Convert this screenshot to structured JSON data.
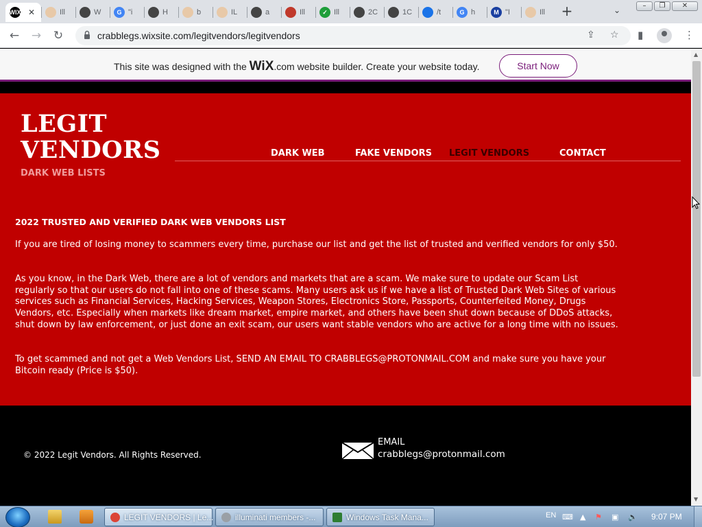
{
  "browser": {
    "tabs": [
      {
        "label": "WIX",
        "title": "",
        "active": true,
        "favicon_color": "#000000",
        "favicon_name": "wix-favicon-icon"
      },
      {
        "label": "",
        "title": "Ill",
        "favicon_color": "#e8c9a8",
        "favicon_name": "pyramid-favicon-icon"
      },
      {
        "label": "",
        "title": "W",
        "favicon_color": "#444444",
        "favicon_name": "globe-favicon-icon"
      },
      {
        "label": "G",
        "title": "\"i",
        "favicon_color": "#4285f4",
        "favicon_name": "google-favicon-icon"
      },
      {
        "label": "",
        "title": "H",
        "favicon_color": "#444444",
        "favicon_name": "globe-favicon-icon"
      },
      {
        "label": "",
        "title": "b",
        "favicon_color": "#e8c9a8",
        "favicon_name": "pyramid-favicon-icon"
      },
      {
        "label": "",
        "title": "IL",
        "favicon_color": "#e8c9a8",
        "favicon_name": "pyramid-favicon-icon"
      },
      {
        "label": "",
        "title": "a",
        "favicon_color": "#444444",
        "favicon_name": "globe-favicon-icon"
      },
      {
        "label": "",
        "title": "Ill",
        "favicon_color": "#c0392b",
        "favicon_name": "red-figure-favicon-icon"
      },
      {
        "label": "✓",
        "title": "Ill",
        "favicon_color": "#1e9e3a",
        "favicon_name": "green-check-favicon-icon"
      },
      {
        "label": "",
        "title": "2C",
        "favicon_color": "#444444",
        "favicon_name": "globe-favicon-icon"
      },
      {
        "label": "",
        "title": "1C",
        "favicon_color": "#444444",
        "favicon_name": "globe-favicon-icon"
      },
      {
        "label": "",
        "title": "/t",
        "favicon_color": "#1a73e8",
        "favicon_name": "cloud-favicon-icon"
      },
      {
        "label": "G",
        "title": "h",
        "favicon_color": "#4285f4",
        "favicon_name": "google-favicon-icon"
      },
      {
        "label": "M",
        "title": "\"I",
        "favicon_color": "#1a3fa0",
        "favicon_name": "malwarebytes-favicon-icon"
      },
      {
        "label": "",
        "title": "Ill",
        "favicon_color": "#e8c9a8",
        "favicon_name": "pyramid-favicon-icon"
      }
    ],
    "new_tab": "+",
    "url": "crabblegs.wixsite.com/legitvendors/legitvendors"
  },
  "wix_banner": {
    "text_before": "This site was designed with the ",
    "brand": "WiX",
    "text_after": ".com website builder. Create your website today.",
    "button": "Start Now"
  },
  "site": {
    "logo_line1": "LEGIT",
    "logo_line2": "VENDORS",
    "logo_subtitle": "DARK WEB LISTS",
    "nav": [
      {
        "label": "DARK WEB"
      },
      {
        "label": "FAKE VENDORS"
      },
      {
        "label": "LEGIT VENDORS",
        "current": true
      },
      {
        "label": "CONTACT"
      }
    ],
    "heading": "2022 TRUSTED AND VERIFIED DARK WEB VENDORS LIST",
    "paragraphs": [
      "If you are tired of losing money to scammers every time, purchase our list and get the list of trusted and verified vendors for only $50.",
      "As you know, in the Dark Web, there are a lot of vendors and markets that are a scam. We make sure to update our Scam List regularly so that our users do not fall into one of these scams. Many users ask us if we have a list of Trusted Dark Web Sites of various services such as Financial Services, Hacking Services, Weapon Stores, Electronics Store, Passports, Counterfeited Money, Drugs Vendors, etc. Especially when markets like dream market, empire market, and others have been shut down because of DDoS attacks, shut down by law enforcement, or just done an exit scam, our users want stable vendors who are active for a long time with no issues.",
      "To get scammed and not get a Web Vendors List, SEND AN EMAIL TO CRABBLEGS@PROTONMAIL.COM and make sure you have your Bitcoin ready (Price is $50)."
    ],
    "footer": {
      "copyright": "© 2022 Legit Vendors. All Rights Reserved.",
      "email_label": "EMAIL",
      "email_address": "crabblegs@protonmail.com"
    },
    "colors": {
      "primary_red": "#c00000",
      "wix_purple": "#7a1d7a",
      "footer_black": "#000000"
    }
  },
  "taskbar": {
    "items": [
      {
        "label": "LEGIT VENDORS | Le...",
        "active": true,
        "icon_color": "#db4437"
      },
      {
        "label": "illuminati members -...",
        "active": false,
        "icon_color": "#9aa0a6"
      },
      {
        "label": "Windows Task Mana...",
        "active": false,
        "icon_color": "#2e7d32"
      }
    ],
    "language": "EN",
    "clock": "9:07 PM"
  }
}
